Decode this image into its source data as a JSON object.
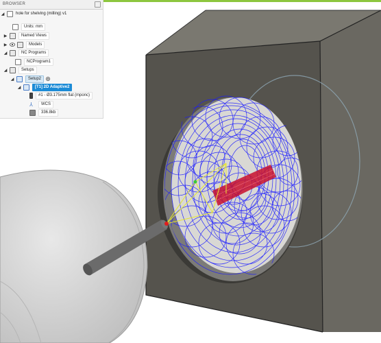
{
  "browser": {
    "title": "BROWSER",
    "document": "hole for shelving (milling) v1",
    "units": "Units: mm",
    "named_views": "Named Views",
    "models": "Models",
    "nc_programs": "NC Programs",
    "nc_program1": "NCProgram1",
    "setups": "Setups",
    "setup2": "Setup2",
    "operation": "[T1] 2D Adaptive2",
    "tool": "#1 - Ø3.175mm flat (mponc)",
    "wcs": "WCS",
    "size": "336.8kb"
  },
  "colors": {
    "accent_bar": "#8dc63f",
    "selection": "#1c8bd6",
    "toolpath_blue": "#1a1aff",
    "lead_yellow": "#e6e62e",
    "ramp_red": "#c8102e",
    "stock_face": "#5a5852"
  }
}
